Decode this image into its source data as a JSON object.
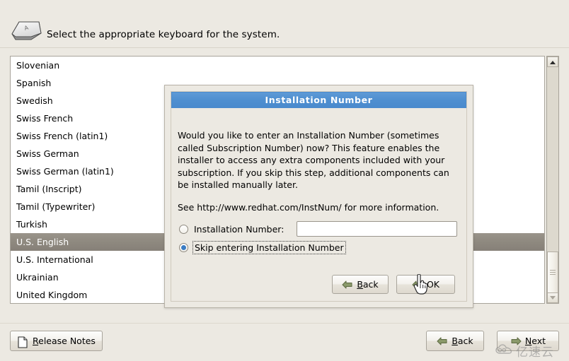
{
  "header": {
    "icon": "keyboard-key-icon",
    "title": "Select the appropriate keyboard for the system."
  },
  "keyboard_list": {
    "selected": "U.S. English",
    "items": [
      "Slovenian",
      "Spanish",
      "Swedish",
      "Swiss French",
      "Swiss French (latin1)",
      "Swiss German",
      "Swiss German (latin1)",
      "Tamil (Inscript)",
      "Tamil (Typewriter)",
      "Turkish",
      "U.S. English",
      "U.S. International",
      "Ukrainian",
      "United Kingdom"
    ]
  },
  "scrollbar": {
    "up_icon": "scroll-up-arrow-icon",
    "down_icon": "scroll-down-arrow-icon",
    "thumb_icon": "scrollbar-grip-icon"
  },
  "dialog": {
    "title": "Installation Number",
    "body": "Would you like to enter an Installation Number (sometimes called Subscription Number) now? This feature enables the installer to access any extra components included with your subscription.  If you skip this step, additional components can be installed manually later.",
    "link_line": "See http://www.redhat.com/InstNum/ for more information.",
    "radio_installation_number": {
      "label": "Installation Number:",
      "checked": false
    },
    "radio_skip": {
      "label": "Skip entering Installation Number",
      "checked": true,
      "focused": true
    },
    "input": {
      "value": "",
      "placeholder": ""
    },
    "back_button": {
      "label_pre": "",
      "accel": "B",
      "label_post": "ack",
      "full": "Back",
      "icon": "left-arrow-icon"
    },
    "ok_button": {
      "full": "OK",
      "icon": "left-arrow-icon"
    }
  },
  "footer": {
    "release_notes": {
      "accel": "R",
      "label_post": "elease Notes",
      "full": "Release Notes",
      "icon": "document-icon"
    },
    "back": {
      "accel": "B",
      "label_post": "ack",
      "full": "Back",
      "icon": "left-arrow-icon"
    },
    "next": {
      "accel": "N",
      "label_post": "ext",
      "full": "Next",
      "icon": "right-arrow-icon"
    }
  },
  "cursor": {
    "icon": "hand-pointer-cursor"
  },
  "watermark": {
    "icon": "cloud-icon",
    "text": "亿速云"
  },
  "colors": {
    "window_bg": "#ece9e2",
    "dialog_title_blue": "#4f8fd0",
    "selection_gray": "#8f8a80",
    "radio_accent": "#3a7cc4",
    "arrow_green": "#7b8a5e"
  }
}
